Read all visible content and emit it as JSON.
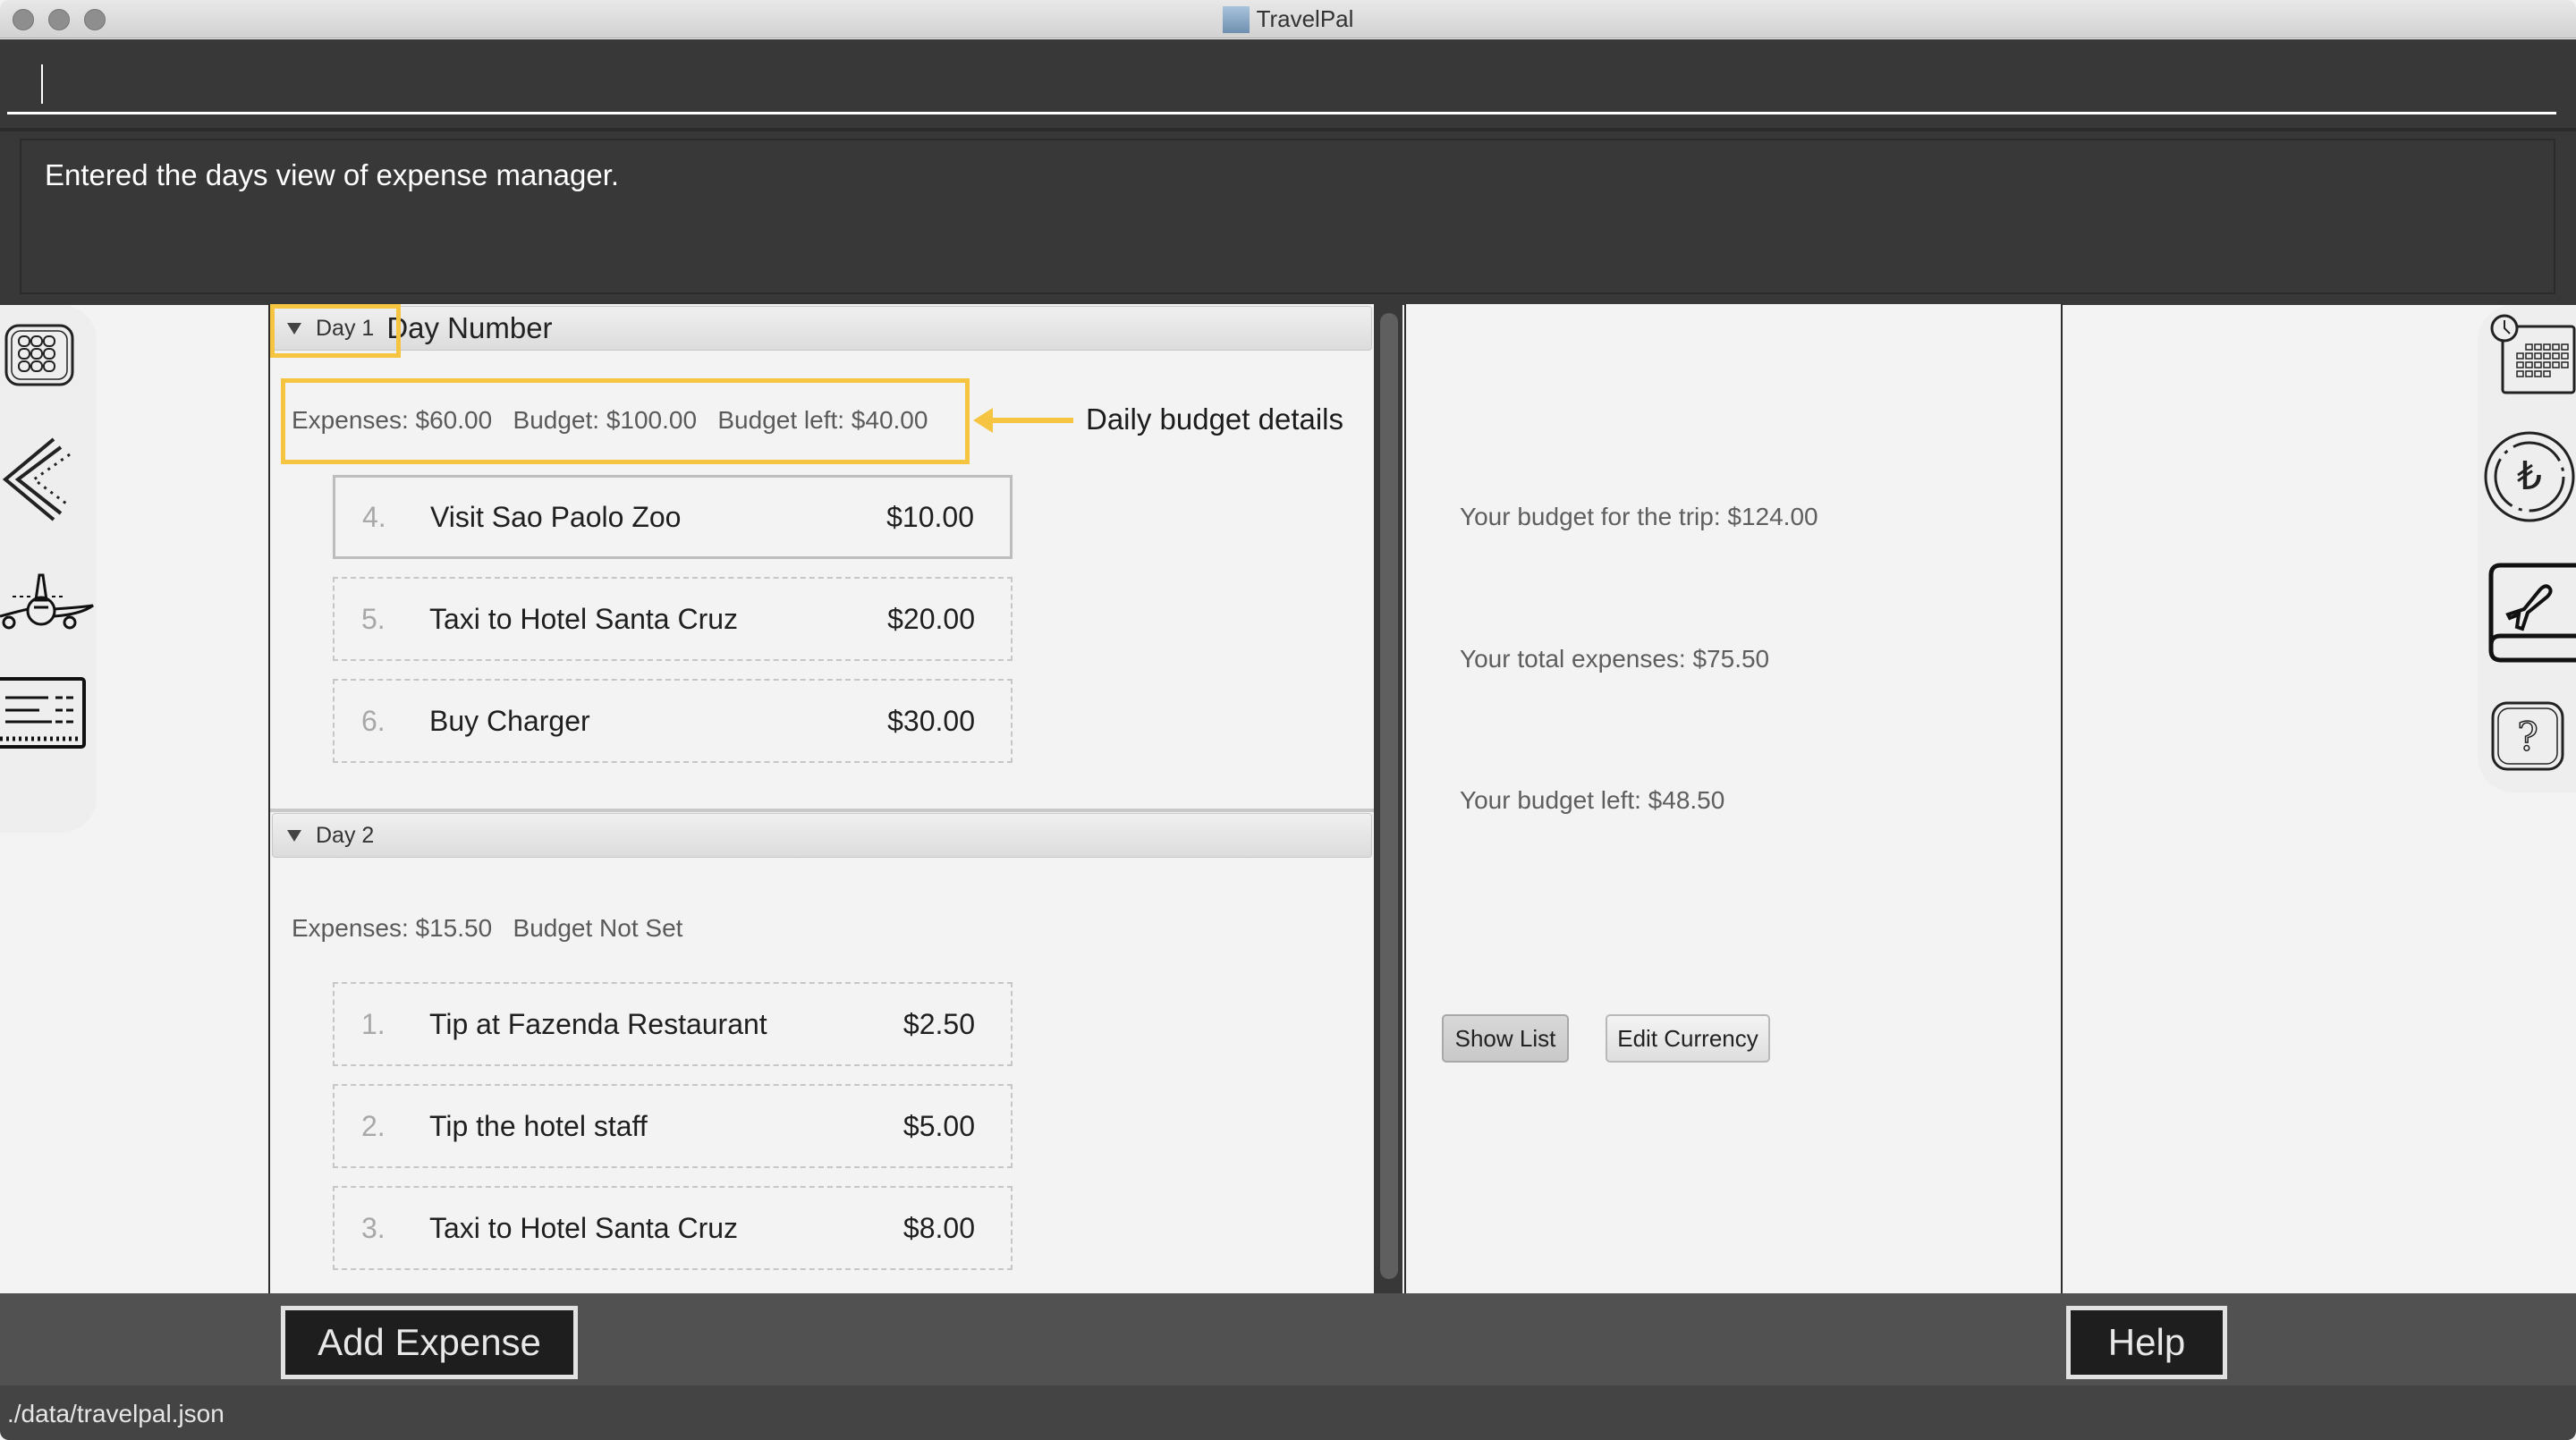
{
  "window": {
    "title": "TravelPal",
    "traffic_lights": [
      "close",
      "minimize",
      "maximize"
    ]
  },
  "command": {
    "value": "",
    "placeholder": ""
  },
  "result": {
    "message": "Entered the days view of expense manager."
  },
  "left_sidebar": {
    "items": [
      {
        "icon": "keypad-icon",
        "label": "Menu"
      },
      {
        "icon": "back-arrow-icon",
        "label": "Back"
      },
      {
        "icon": "airplane-icon",
        "label": "Trip"
      },
      {
        "icon": "ticket-list-icon",
        "label": "List"
      }
    ]
  },
  "right_sidebar": {
    "items": [
      {
        "icon": "calendar-clock-icon",
        "label": "Itinerary"
      },
      {
        "icon": "currency-coin-icon",
        "label": "Currency"
      },
      {
        "icon": "travel-book-icon",
        "label": "Bookings"
      },
      {
        "icon": "help-icon",
        "label": "Help"
      }
    ]
  },
  "annotations": {
    "day_number": "Day Number",
    "daily_budget": "Daily budget details",
    "highlight_color": "#f5c542"
  },
  "days": [
    {
      "title": "Day 1",
      "expenses_text": "Expenses: $60.00",
      "budget_text": "Budget: $100.00",
      "budget_left_text": "Budget left: $40.00",
      "items": [
        {
          "index": "4.",
          "name": "Visit Sao Paolo Zoo",
          "amount": "$10.00",
          "selected": true
        },
        {
          "index": "5.",
          "name": "Taxi to Hotel Santa Cruz",
          "amount": "$20.00",
          "selected": false
        },
        {
          "index": "6.",
          "name": "Buy Charger",
          "amount": "$30.00",
          "selected": false
        }
      ]
    },
    {
      "title": "Day 2",
      "expenses_text": "Expenses: $15.50",
      "budget_text": "Budget Not Set",
      "budget_left_text": "",
      "items": [
        {
          "index": "1.",
          "name": "Tip at Fazenda Restaurant",
          "amount": "$2.50",
          "selected": false
        },
        {
          "index": "2.",
          "name": "Tip the hotel staff",
          "amount": "$5.00",
          "selected": false
        },
        {
          "index": "3.",
          "name": "Taxi to Hotel Santa Cruz",
          "amount": "$8.00",
          "selected": false
        }
      ]
    }
  ],
  "summary": {
    "trip_budget": "Your budget for the trip: $124.00",
    "total_expenses": "Your total expenses: $75.50",
    "budget_left": "Your budget left: $48.50",
    "show_list_label": "Show List",
    "edit_currency_label": "Edit Currency"
  },
  "bottom": {
    "add_expense_label": "Add Expense",
    "help_label": "Help"
  },
  "status": {
    "file_path": "./data/travelpal.json"
  }
}
